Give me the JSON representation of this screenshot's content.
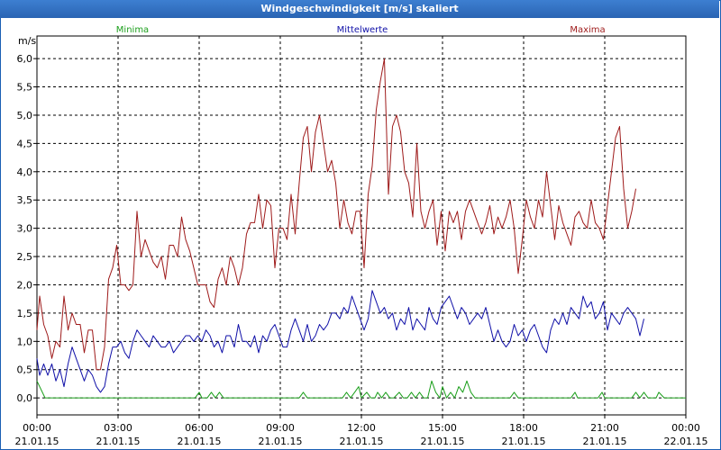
{
  "window": {
    "title": "Windgeschwindigkeit [m/s] skaliert"
  },
  "colors": {
    "minima": "#1a9e1a",
    "mittelwerte": "#1010a8",
    "maxima": "#9e1a1a",
    "grid": "#000000",
    "frame": "#1a5fb4"
  },
  "chart_data": {
    "type": "line",
    "title": "Windgeschwindigkeit [m/s] skaliert",
    "ylabel": "m/s",
    "ylim": [
      -0.3,
      6.4
    ],
    "yticks": [
      "0,0",
      "0,5",
      "1,0",
      "1,5",
      "2,0",
      "2,5",
      "3,0",
      "3,5",
      "4,0",
      "4,5",
      "5,0",
      "5,5",
      "6,0"
    ],
    "ytick_values": [
      0.0,
      0.5,
      1.0,
      1.5,
      2.0,
      2.5,
      3.0,
      3.5,
      4.0,
      4.5,
      5.0,
      5.5,
      6.0
    ],
    "xticks_time": [
      "00:00",
      "03:00",
      "06:00",
      "09:00",
      "12:00",
      "15:00",
      "18:00",
      "21:00",
      "00:00"
    ],
    "xticks_date": [
      "21.01.15",
      "21.01.15",
      "21.01.15",
      "21.01.15",
      "21.01.15",
      "21.01.15",
      "21.01.15",
      "21.01.15",
      "22.01.15"
    ],
    "xlim_hours": [
      0,
      24
    ],
    "grid": true,
    "legend_position": "top",
    "series": [
      {
        "name": "Maxima",
        "color": "#9e1a1a",
        "x_hours": [
          0.0,
          0.1,
          0.25,
          0.4,
          0.55,
          0.7,
          0.85,
          1.0,
          1.15,
          1.3,
          1.45,
          1.6,
          1.75,
          1.9,
          2.05,
          2.2,
          2.35,
          2.5,
          2.65,
          2.8,
          2.95,
          3.1,
          3.25,
          3.4,
          3.55,
          3.7,
          3.85,
          4.0,
          4.15,
          4.3,
          4.45,
          4.6,
          4.75,
          4.9,
          5.05,
          5.2,
          5.35,
          5.5,
          5.65,
          5.8,
          5.95,
          6.1,
          6.25,
          6.4,
          6.55,
          6.7,
          6.85,
          7.0,
          7.15,
          7.3,
          7.45,
          7.6,
          7.75,
          7.9,
          8.05,
          8.2,
          8.35,
          8.5,
          8.65,
          8.8,
          8.95,
          9.1,
          9.25,
          9.4,
          9.55,
          9.7,
          9.85,
          10.0,
          10.15,
          10.3,
          10.45,
          10.6,
          10.75,
          10.9,
          11.05,
          11.2,
          11.35,
          11.5,
          11.65,
          11.8,
          11.95,
          12.1,
          12.25,
          12.4,
          12.55,
          12.7,
          12.85,
          13.0,
          13.15,
          13.3,
          13.45,
          13.6,
          13.75,
          13.9,
          14.05,
          14.2,
          14.35,
          14.5,
          14.65,
          14.8,
          14.95,
          15.1,
          15.25,
          15.4,
          15.55,
          15.7,
          15.85,
          16.0,
          16.15,
          16.3,
          16.45,
          16.6,
          16.75,
          16.9,
          17.05,
          17.2,
          17.35,
          17.5,
          17.65,
          17.8,
          17.95,
          18.1,
          18.25,
          18.4,
          18.55,
          18.7,
          18.85,
          19.0,
          19.15,
          19.3,
          19.45,
          19.6,
          19.75,
          19.9,
          20.05,
          20.2,
          20.35,
          20.5,
          20.65,
          20.8,
          20.95,
          21.1,
          21.25,
          21.4,
          21.55,
          21.7,
          21.85,
          22.0,
          22.15,
          22.3,
          22.45,
          22.6,
          22.75,
          22.9,
          23.05,
          23.2,
          23.35,
          23.5,
          23.65,
          23.8,
          23.95
        ],
        "values": [
          1.2,
          1.8,
          1.3,
          1.1,
          0.7,
          1.0,
          0.9,
          1.8,
          1.2,
          1.5,
          1.3,
          1.3,
          0.8,
          1.2,
          1.2,
          0.5,
          0.5,
          0.9,
          2.1,
          2.3,
          2.7,
          2.0,
          2.0,
          1.9,
          2.0,
          3.3,
          2.5,
          2.8,
          2.6,
          2.4,
          2.3,
          2.5,
          2.1,
          2.7,
          2.7,
          2.5,
          3.2,
          2.8,
          2.6,
          2.3,
          2.0,
          2.0,
          2.0,
          1.7,
          1.6,
          2.1,
          2.3,
          2.0,
          2.5,
          2.3,
          2.0,
          2.3,
          2.9,
          3.1,
          3.1,
          3.6,
          3.0,
          3.5,
          3.4,
          2.3,
          3.0,
          3.0,
          2.8,
          3.6,
          2.9,
          3.8,
          4.6,
          4.8,
          4.0,
          4.7,
          5.0,
          4.5,
          4.0,
          4.2,
          3.8,
          3.0,
          3.5,
          3.1,
          2.9,
          3.3,
          3.3,
          2.3,
          3.6,
          4.1,
          5.1,
          5.6,
          6.0,
          3.6,
          4.8,
          5.0,
          4.7,
          4.0,
          3.8,
          3.2,
          4.5,
          3.3,
          3.0,
          3.3,
          3.5,
          2.7,
          3.3,
          2.6,
          3.3,
          3.1,
          3.3,
          2.8,
          3.3,
          3.5,
          3.3,
          3.1,
          2.9,
          3.1,
          3.4,
          2.9,
          3.2,
          3.0,
          3.2,
          3.5,
          3.0,
          2.2,
          2.8,
          3.5,
          3.2,
          3.0,
          3.5,
          3.2,
          4.0,
          3.4,
          2.8,
          3.4,
          3.1,
          2.9,
          2.7,
          3.2,
          3.3,
          3.1,
          3.0,
          3.5,
          3.1,
          3.0,
          2.8,
          3.4,
          4.0,
          4.6,
          4.8,
          3.7,
          3.0,
          3.3,
          3.7
        ]
      },
      {
        "name": "Mittelwerte",
        "color": "#1010a8",
        "x_hours": [
          0.0,
          0.1,
          0.25,
          0.4,
          0.55,
          0.7,
          0.85,
          1.0,
          1.15,
          1.3,
          1.45,
          1.6,
          1.75,
          1.9,
          2.05,
          2.2,
          2.35,
          2.5,
          2.65,
          2.8,
          2.95,
          3.1,
          3.25,
          3.4,
          3.55,
          3.7,
          3.85,
          4.0,
          4.15,
          4.3,
          4.45,
          4.6,
          4.75,
          4.9,
          5.05,
          5.2,
          5.35,
          5.5,
          5.65,
          5.8,
          5.95,
          6.1,
          6.25,
          6.4,
          6.55,
          6.7,
          6.85,
          7.0,
          7.15,
          7.3,
          7.45,
          7.6,
          7.75,
          7.9,
          8.05,
          8.2,
          8.35,
          8.5,
          8.65,
          8.8,
          8.95,
          9.1,
          9.25,
          9.4,
          9.55,
          9.7,
          9.85,
          10.0,
          10.15,
          10.3,
          10.45,
          10.6,
          10.75,
          10.9,
          11.05,
          11.2,
          11.35,
          11.5,
          11.65,
          11.8,
          11.95,
          12.1,
          12.25,
          12.4,
          12.55,
          12.7,
          12.85,
          13.0,
          13.15,
          13.3,
          13.45,
          13.6,
          13.75,
          13.9,
          14.05,
          14.2,
          14.35,
          14.5,
          14.65,
          14.8,
          14.95,
          15.1,
          15.25,
          15.4,
          15.55,
          15.7,
          15.85,
          16.0,
          16.15,
          16.3,
          16.45,
          16.6,
          16.75,
          16.9,
          17.05,
          17.2,
          17.35,
          17.5,
          17.65,
          17.8,
          17.95,
          18.1,
          18.25,
          18.4,
          18.55,
          18.7,
          18.85,
          19.0,
          19.15,
          19.3,
          19.45,
          19.6,
          19.75,
          19.9,
          20.05,
          20.2,
          20.35,
          20.5,
          20.65,
          20.8,
          20.95,
          21.1,
          21.25,
          21.4,
          21.55,
          21.7,
          21.85,
          22.0,
          22.15,
          22.3,
          22.45,
          22.6,
          22.75,
          22.9,
          23.05,
          23.2,
          23.35,
          23.5,
          23.65,
          23.8,
          23.95
        ],
        "values": [
          0.7,
          0.4,
          0.6,
          0.4,
          0.6,
          0.3,
          0.5,
          0.2,
          0.6,
          0.9,
          0.7,
          0.5,
          0.3,
          0.5,
          0.4,
          0.2,
          0.1,
          0.2,
          0.6,
          0.9,
          0.9,
          1.0,
          0.8,
          0.7,
          1.0,
          1.2,
          1.1,
          1.0,
          0.9,
          1.1,
          1.0,
          0.9,
          0.9,
          1.0,
          0.8,
          0.9,
          1.0,
          1.1,
          1.1,
          1.0,
          1.1,
          1.0,
          1.2,
          1.1,
          0.9,
          1.0,
          0.8,
          1.1,
          1.1,
          0.9,
          1.3,
          1.0,
          1.0,
          0.9,
          1.1,
          0.8,
          1.1,
          1.0,
          1.2,
          1.3,
          1.1,
          0.9,
          0.9,
          1.2,
          1.4,
          1.2,
          1.0,
          1.3,
          1.0,
          1.1,
          1.3,
          1.2,
          1.3,
          1.5,
          1.5,
          1.4,
          1.6,
          1.5,
          1.8,
          1.6,
          1.4,
          1.2,
          1.4,
          1.9,
          1.7,
          1.5,
          1.6,
          1.4,
          1.5,
          1.2,
          1.4,
          1.3,
          1.6,
          1.2,
          1.4,
          1.3,
          1.2,
          1.6,
          1.4,
          1.3,
          1.6,
          1.7,
          1.8,
          1.6,
          1.4,
          1.6,
          1.5,
          1.3,
          1.4,
          1.5,
          1.4,
          1.6,
          1.3,
          1.0,
          1.2,
          1.0,
          0.9,
          1.0,
          1.3,
          1.1,
          1.2,
          1.0,
          1.2,
          1.3,
          1.1,
          0.9,
          0.8,
          1.2,
          1.4,
          1.3,
          1.5,
          1.3,
          1.6,
          1.5,
          1.4,
          1.8,
          1.6,
          1.7,
          1.4,
          1.5,
          1.7,
          1.2,
          1.5,
          1.4,
          1.3,
          1.5,
          1.6,
          1.5,
          1.4,
          1.1,
          1.4
        ]
      },
      {
        "name": "Minima",
        "color": "#1a9e1a",
        "x_hours": [
          0.0,
          0.3,
          1.0,
          2.0,
          3.0,
          4.0,
          5.0,
          5.85,
          6.0,
          6.1,
          6.3,
          6.45,
          6.6,
          6.75,
          6.9,
          7.5,
          8.0,
          8.5,
          9.0,
          9.7,
          9.85,
          10.0,
          10.5,
          11.0,
          11.3,
          11.45,
          11.6,
          11.75,
          11.9,
          12.0,
          12.2,
          12.35,
          12.5,
          12.6,
          12.75,
          12.9,
          13.05,
          13.2,
          13.4,
          13.55,
          13.7,
          13.85,
          14.0,
          14.15,
          14.3,
          14.45,
          14.6,
          14.75,
          14.9,
          15.0,
          15.15,
          15.3,
          15.45,
          15.6,
          15.75,
          15.9,
          16.05,
          16.2,
          16.35,
          16.5,
          16.65,
          16.8,
          17.0,
          17.5,
          17.65,
          17.8,
          17.95,
          18.0,
          18.5,
          19.0,
          19.5,
          19.75,
          19.9,
          20.0,
          20.5,
          20.75,
          20.9,
          21.0,
          21.5,
          21.75,
          21.9,
          22.0,
          22.15,
          22.3,
          22.45,
          22.6,
          22.75,
          22.9,
          23.0,
          23.2,
          23.35,
          23.5,
          23.65,
          23.8,
          24.0
        ],
        "values": [
          0.3,
          0.0,
          0.0,
          0.0,
          0.0,
          0.0,
          0.0,
          0.0,
          0.1,
          0.0,
          0.0,
          0.1,
          0.0,
          0.1,
          0.0,
          0.0,
          0.0,
          0.0,
          0.0,
          0.0,
          0.1,
          0.0,
          0.0,
          0.0,
          0.0,
          0.1,
          0.0,
          0.1,
          0.2,
          0.0,
          0.1,
          0.0,
          0.0,
          0.1,
          0.0,
          0.1,
          0.0,
          0.0,
          0.1,
          0.0,
          0.0,
          0.1,
          0.0,
          0.1,
          0.0,
          0.0,
          0.3,
          0.1,
          0.0,
          0.2,
          0.0,
          0.1,
          0.0,
          0.2,
          0.1,
          0.3,
          0.1,
          0.0,
          0.0,
          0.0,
          0.0,
          0.0,
          0.0,
          0.0,
          0.1,
          0.0,
          0.0,
          0.0,
          0.0,
          0.0,
          0.0,
          0.0,
          0.1,
          0.0,
          0.0,
          0.0,
          0.1,
          0.0,
          0.0,
          0.0,
          0.0,
          0.0,
          0.1,
          0.0,
          0.1,
          0.0,
          0.0,
          0.0,
          0.1,
          0.0,
          0.0,
          0.0,
          0.0,
          0.0,
          0.0
        ]
      }
    ]
  }
}
